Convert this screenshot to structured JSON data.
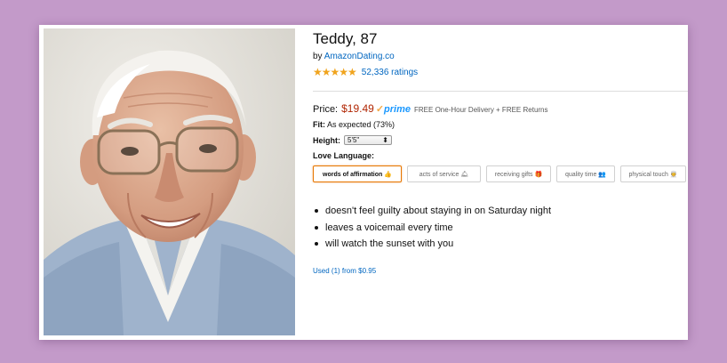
{
  "product": {
    "title": "Teddy, 87",
    "by_label": "by",
    "seller": "AmazonDating.co",
    "stars": "★★★★★",
    "rating_count": "52,336 ratings",
    "price_label": "Price:",
    "price": "$19.49",
    "prime_check": "✓",
    "prime_label": "prime",
    "delivery": "FREE One-Hour Delivery + FREE Returns",
    "fit_label": "Fit:",
    "fit_value": "As expected (73%)",
    "height_label": "Height:",
    "height_value": "5'5\"",
    "height_arrow": "⬍",
    "love_language_label": "Love Language:",
    "love_languages": [
      {
        "label": "words of affirmation 👍",
        "selected": true
      },
      {
        "label": "acts of service 🛎",
        "selected": false
      },
      {
        "label": "receiving gifts 🎁",
        "selected": false
      },
      {
        "label": "quality time 👥",
        "selected": false
      },
      {
        "label": "physical touch 👳",
        "selected": false
      }
    ],
    "features": [
      "doesn't feel guilty about staying in on Saturday night",
      "leaves a voicemail every time",
      "will watch the sunset with you"
    ],
    "used_offer": "Used (1) from $0.95"
  },
  "colors": {
    "background": "#c39ac9",
    "price": "#b12704",
    "link": "#0066c0",
    "prime": "#1a98ff",
    "star": "#f0a41e",
    "selected_border": "#e77600"
  },
  "icons": {
    "photo": "elderly-man-portrait"
  }
}
